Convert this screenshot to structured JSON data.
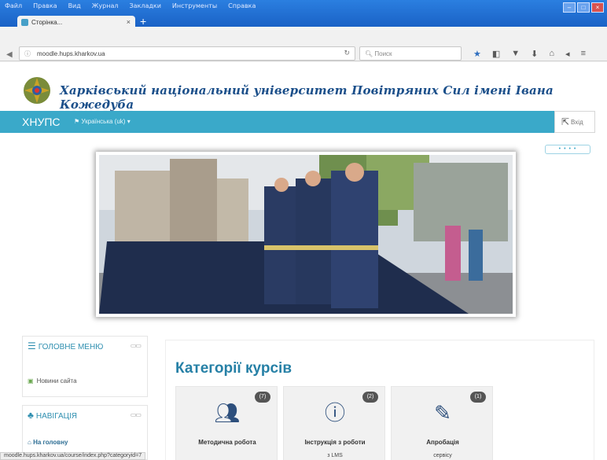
{
  "browser": {
    "menu": [
      "Файл",
      "Правка",
      "Вид",
      "Журнал",
      "Закладки",
      "Инструменты",
      "Справка"
    ],
    "tab_title": "Сторінка...",
    "url": "moodle.hups.kharkov.ua",
    "search_placeholder": "Поиск",
    "status_url": "moodle.hups.kharkov.ua/course/index.php?categoryid=7"
  },
  "header": {
    "site_title": "Харківський національний університет Повітряних Сил імені Івана Кожедуба"
  },
  "nav": {
    "brand": "ХНУПС",
    "language": "Українська (uk)",
    "login_label": "Вхід",
    "slider_dots": "• • • •"
  },
  "sidebar": {
    "main_menu": {
      "title": "Головне меню",
      "items": [
        {
          "label": "Новини сайта"
        }
      ]
    },
    "navigation": {
      "title": "Навігація",
      "items": [
        {
          "label": "На головну"
        }
      ]
    }
  },
  "main": {
    "title": "Категорії курсів",
    "cards": [
      {
        "label": "Методична робота",
        "count": "(7)",
        "icon": "users-icon",
        "sub": ""
      },
      {
        "label": "Інструкція з роботи",
        "count": "(2)",
        "icon": "info-icon",
        "sub": "з LMS"
      },
      {
        "label": "Апробація",
        "count": "(1)",
        "icon": "edit-icon",
        "sub": "сервісу"
      }
    ]
  },
  "colors": {
    "accent": "#3aa9c9",
    "title": "#1b4f8a",
    "titlebar": "#1f6fd6"
  }
}
